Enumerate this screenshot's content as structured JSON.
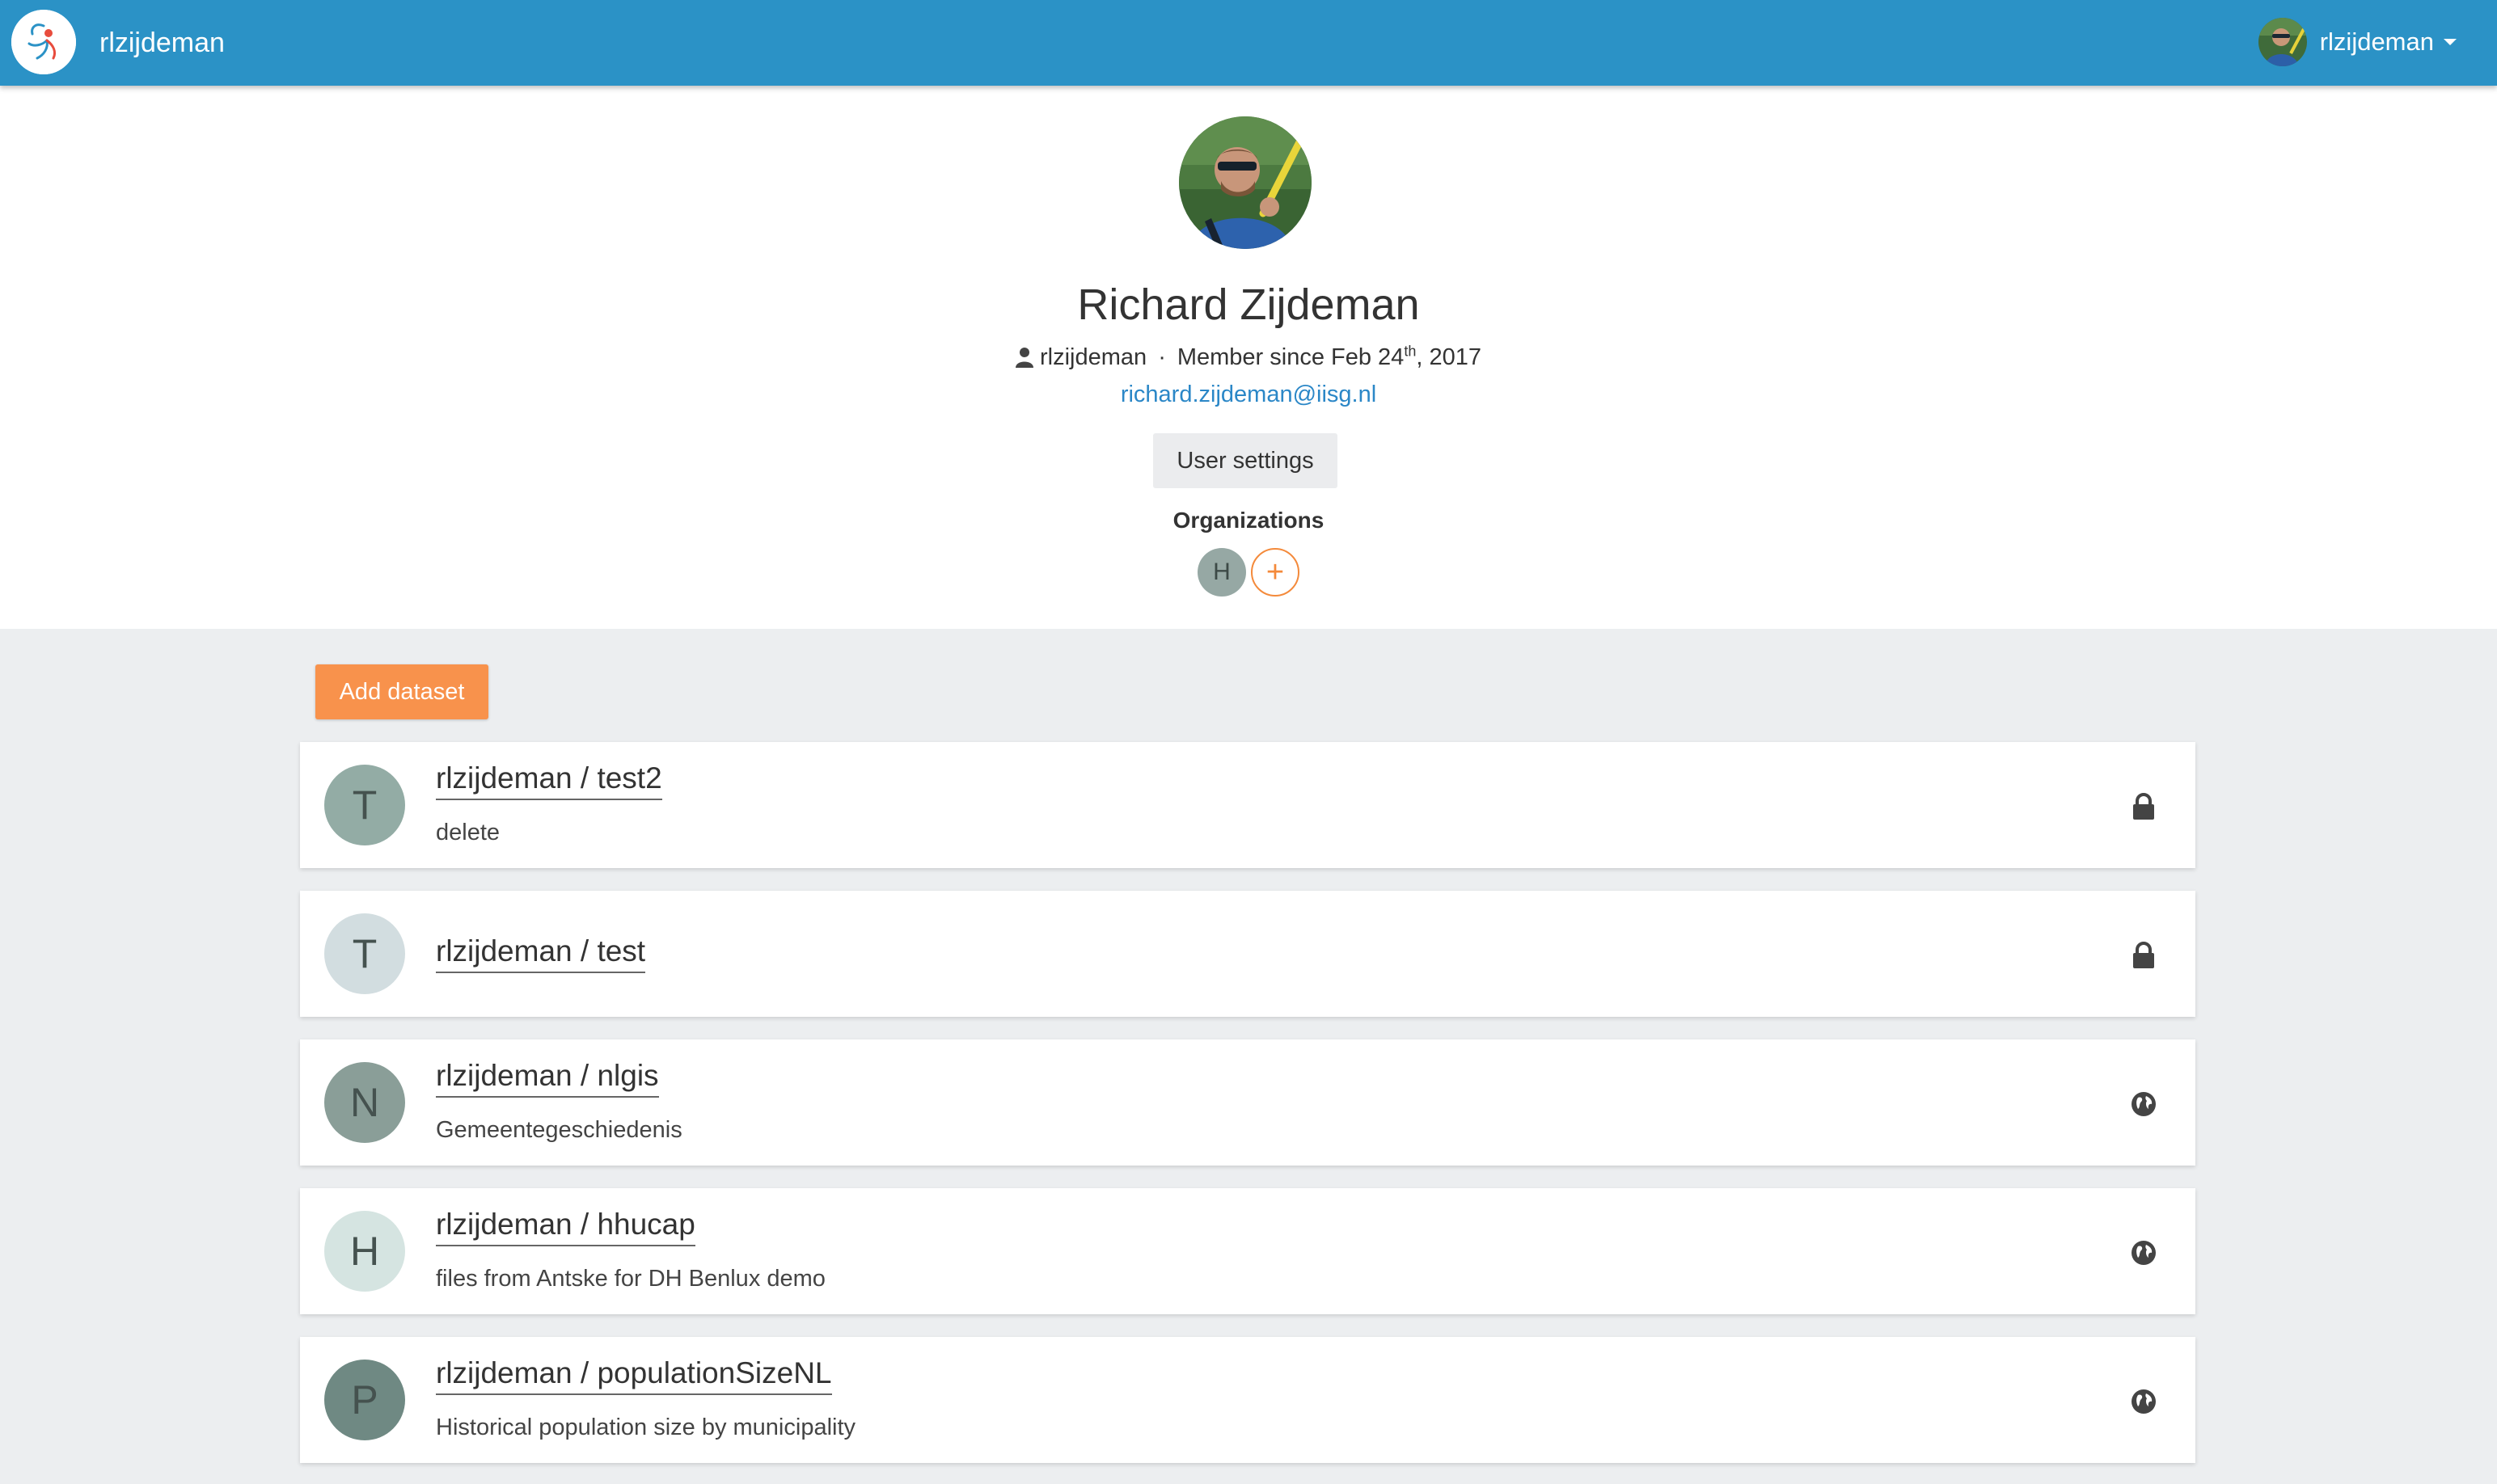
{
  "navbar": {
    "brand_name": "rlzijdeman",
    "user_name": "rlzijdeman"
  },
  "profile": {
    "full_name": "Richard Zijdeman",
    "username": "rlzijdeman",
    "separator": "·",
    "member_since_prefix": "Member since Feb 24",
    "member_since_suffix": "th",
    "member_since_year": ", 2017",
    "email": "richard.zijdeman@iisg.nl",
    "settings_label": "User settings",
    "organizations_title": "Organizations",
    "organizations": [
      {
        "initial": "H"
      }
    ],
    "add_org_symbol": "+"
  },
  "add_dataset_label": "Add dataset",
  "datasets": [
    {
      "initial": "T",
      "title": "rlzijdeman / test2",
      "description": "delete",
      "visibility": "private",
      "icon": "lock-icon",
      "avatar_color": "#93aca5"
    },
    {
      "initial": "T",
      "title": "rlzijdeman / test",
      "description": "",
      "visibility": "private",
      "icon": "lock-icon",
      "avatar_color": "#d2dde0"
    },
    {
      "initial": "N",
      "title": "rlzijdeman / nlgis",
      "description": "Gemeentegeschiedenis",
      "visibility": "public",
      "icon": "globe-icon",
      "avatar_color": "#8a9e98"
    },
    {
      "initial": "H",
      "title": "rlzijdeman / hhucap",
      "description": "files from Antske for DH Benlux demo",
      "visibility": "public",
      "icon": "globe-icon",
      "avatar_color": "#d5e4e1"
    },
    {
      "initial": "P",
      "title": "rlzijdeman / populationSizeNL",
      "description": "Historical population size by municipality",
      "visibility": "public",
      "icon": "globe-icon",
      "avatar_color": "#6f8983"
    }
  ],
  "colors": {
    "navbar": "#2b92c6",
    "accent": "#f8924c",
    "link": "#2b87c7"
  }
}
